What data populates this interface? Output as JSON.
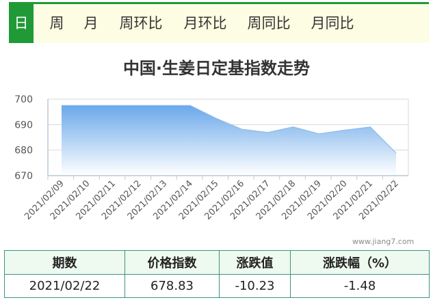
{
  "tabs": [
    {
      "label": "日",
      "active": true
    },
    {
      "label": "周",
      "active": false
    },
    {
      "label": "月",
      "active": false
    },
    {
      "label": "周环比",
      "active": false
    },
    {
      "label": "月环比",
      "active": false
    },
    {
      "label": "周同比",
      "active": false
    },
    {
      "label": "月同比",
      "active": false
    }
  ],
  "watermark": "www.jiang7.com",
  "chart_data": {
    "type": "area",
    "title": "中国·生姜日定基指数走势",
    "xlabel": "",
    "ylabel": "",
    "categories": [
      "2021/02/09",
      "2021/02/10",
      "2021/02/11",
      "2021/02/12",
      "2021/02/13",
      "2021/02/14",
      "2021/02/15",
      "2021/02/16",
      "2021/02/17",
      "2021/02/18",
      "2021/02/19",
      "2021/02/20",
      "2021/02/21",
      "2021/02/22"
    ],
    "ylim": [
      670,
      700
    ],
    "yticks": [
      670,
      680,
      690,
      700
    ],
    "grid": true,
    "legend": "none",
    "series": [
      {
        "values": [
          697.5,
          697.5,
          697.5,
          697.5,
          697.5,
          697.5,
          692.5,
          688.2,
          686.9,
          689.1,
          686.4,
          687.8,
          689.1,
          678.83
        ]
      }
    ],
    "colors": {
      "fill_top": "#6aa8ea",
      "fill_bottom": "#ffffff",
      "line": "#8fbbe8",
      "grid": "#d8d8d8",
      "axis": "#b9c8d6"
    }
  },
  "summary_table": {
    "headers": [
      "期数",
      "价格指数",
      "涨跌值",
      "涨跌幅（%）"
    ],
    "row": [
      "2021/02/22",
      "678.83",
      "-10.23",
      "-1.48"
    ]
  }
}
